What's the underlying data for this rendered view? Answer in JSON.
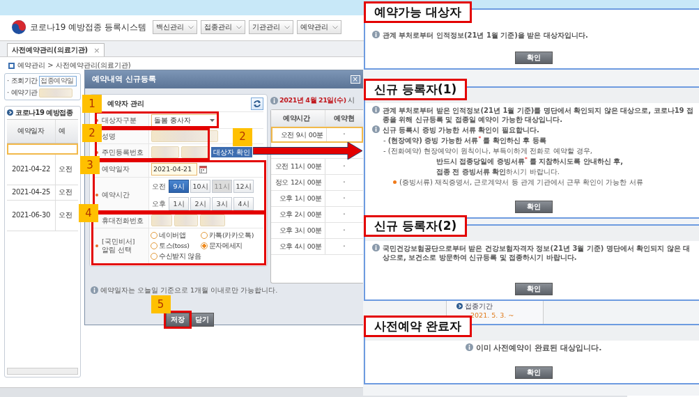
{
  "header": {
    "title": "코로나19 예방접종 등록시스템",
    "menus": [
      "백신관리",
      "접종관리",
      "기관관리",
      "예약관리"
    ]
  },
  "tabs": [
    {
      "label": "사전예약관리(의료기관)",
      "selected": true,
      "close": "×"
    }
  ],
  "breadcrumb": "예약관리 > 사전예약관리(의료기관)",
  "search": {
    "fields": [
      {
        "label": "· 조회기간",
        "value": "접종예약일"
      },
      {
        "label": "· 예약기관"
      }
    ]
  },
  "list": {
    "title": "코로나19 예방접종",
    "columns": [
      "예약일자",
      "예"
    ],
    "rows": [
      {
        "kind": "new",
        "selected": true
      },
      {
        "kind": "data",
        "selected": false,
        "cells": [
          "2021-04-22",
          "오전"
        ]
      },
      {
        "kind": "data",
        "selected": false,
        "cells": [
          "2021-04-25",
          "오전"
        ]
      },
      {
        "kind": "data",
        "selected": false,
        "cells": [
          "2021-06-30",
          "오전"
        ]
      }
    ]
  },
  "dialog": {
    "title": "예약내역 신규등록",
    "close": "×",
    "section": "예약자 관리",
    "fields": [
      {
        "kind": "select",
        "label": "대상자구분",
        "required": true,
        "value": "돌봄 종사자"
      },
      {
        "kind": "name",
        "label": "성명",
        "required": false
      },
      {
        "kind": "id",
        "label": "주민등록번호",
        "required": true,
        "button": "대상자 확인"
      },
      {
        "kind": "date",
        "label": "예약일자",
        "required": false,
        "value": "2021-04-21"
      },
      {
        "kind": "time",
        "label": "예약시간",
        "required": true,
        "groups": [
          {
            "label": "오전",
            "slots": [
              {
                "label": "9시",
                "selected": true,
                "disabled": false
              },
              {
                "label": "10시",
                "selected": false,
                "disabled": false
              },
              {
                "label": "11시",
                "selected": false,
                "disabled": true
              },
              {
                "label": "12시",
                "selected": false,
                "disabled": false
              }
            ]
          },
          {
            "label": "오후",
            "slots": [
              {
                "label": "1시",
                "selected": false,
                "disabled": false
              },
              {
                "label": "2시",
                "selected": false,
                "disabled": false
              },
              {
                "label": "3시",
                "selected": false,
                "disabled": false
              },
              {
                "label": "4시",
                "selected": false,
                "disabled": false
              }
            ]
          }
        ]
      },
      {
        "kind": "phone",
        "label": "휴대전화번호",
        "required": false
      },
      {
        "kind": "radio",
        "label": "[국민비서] 알림 선택",
        "required": true,
        "options": [
          {
            "label": "네이버앱",
            "selected": false
          },
          {
            "label": "카톡(카카오톡)",
            "selected": false
          },
          {
            "label": "토스(toss)",
            "selected": false
          },
          {
            "label": "문자메세지",
            "selected": true
          },
          {
            "label": "수신받지 않음",
            "selected": false
          }
        ]
      }
    ],
    "note": "예약일자는 오늘일 기준으로 1개월 이내로만 가능합니다.",
    "buttons": [
      "저장",
      "닫기"
    ],
    "schedule": {
      "date": "2021년 4월 21일(수)",
      "suffix": "시",
      "columns": [
        "예약시간",
        "예약현"
      ],
      "rows": [
        {
          "kind": "slot",
          "time": "오전 9시 00분",
          "status": "·",
          "selected": true
        },
        {
          "kind": "slot",
          "time": "오전 11시 00분",
          "status": "·",
          "selected": false
        },
        {
          "kind": "slot",
          "time": "정오 12시 00분",
          "status": "·",
          "selected": false
        },
        {
          "kind": "slot",
          "time": "오후 1시 00분",
          "status": "·",
          "selected": false
        },
        {
          "kind": "slot",
          "time": "오후 2시 00분",
          "status": "·",
          "selected": false
        },
        {
          "kind": "slot",
          "time": "오후 3시 00분",
          "status": "·",
          "selected": false
        },
        {
          "kind": "slot",
          "time": "오후 4시 00분",
          "status": "·",
          "selected": false
        }
      ]
    }
  },
  "steps": [
    "1",
    "2",
    "3",
    "4",
    "5",
    "2"
  ],
  "background": {
    "period_label": "접종기간",
    "period": "2021. 5. 3. ~"
  },
  "callouts": [
    {
      "title": "예약가능 대상자",
      "button": "확인",
      "lines": [
        {
          "kind": "info",
          "text": "관계 부처로부터 인적정보(21년 1월 기준)을 받은 대상자입니다."
        }
      ]
    },
    {
      "title": "신규 등록자(1)",
      "button": "확인",
      "lines": [
        {
          "kind": "info",
          "text": "관계 부처로부터 받은 인적정보(21년 1월 기준)를 명단에서 확인되지 않은 대상으로, 코로나19 접종을 위해 신규등록 및 접종일 예약이 가능한 대상입니다."
        },
        {
          "kind": "info",
          "text": "신규 등록시 증빙 가능한 서류 확인이 필요합니다."
        },
        {
          "kind": "dash",
          "text": "- **(현장예약) 증빙 가능한 서류**$^{*}$ **를 확인하신 후 등록**"
        },
        {
          "kind": "dash",
          "text": "- (전화예약) 현장예약이 원칙이나, 부득이하게 전화로 예약할 경우,"
        },
        {
          "kind": "cont",
          "text": "**반드시 접종당일에 증빙서류**$^{*}$ **를 지참하시도록 안내하신 후,**"
        },
        {
          "kind": "cont",
          "text": "**접종 전 증빙서류 확인**하시기 바랍니다."
        },
        {
          "kind": "note",
          "text": "(증빙서류) 재직증명서, 근로계약서 등 관계 기관에서 근무 확인이 가능한 서류"
        }
      ]
    },
    {
      "title": "신규 등록자(2)",
      "button": "확인",
      "lines": [
        {
          "kind": "info",
          "text": "국민건강보험공단으로부터 받은 건강보험자격자 정보(21년 3월 기준) 명단에서 확인되지 않은 대상으로, **보건소로 방문하여 신규등록 및 접종**하시기 바랍니다."
        }
      ]
    },
    {
      "title": "사전예약 완료자",
      "button": "확인",
      "lines": [
        {
          "kind": "center",
          "text": "이미 사전예약이 완료된 대상입니다."
        }
      ]
    }
  ]
}
